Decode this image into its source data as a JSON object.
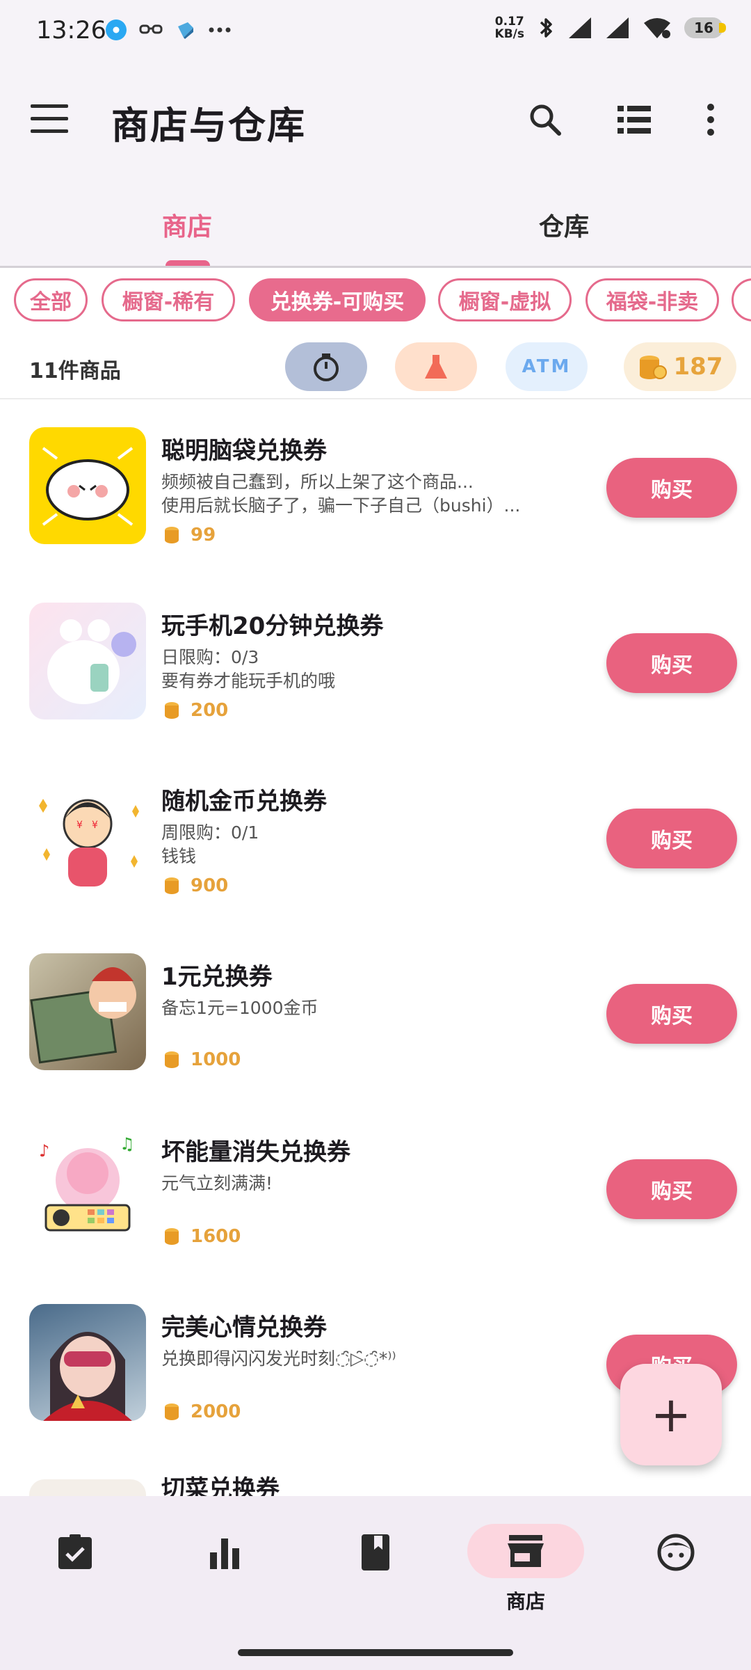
{
  "status_bar": {
    "time": "13:26",
    "net_speed": "0.17",
    "net_unit": "KB/s",
    "battery": "16"
  },
  "app_bar": {
    "title": "商店与仓库",
    "icons": [
      "menu-icon",
      "search-icon",
      "list-icon",
      "more-vert-icon"
    ]
  },
  "tabs": [
    {
      "label": "商店"
    },
    {
      "label": "仓库"
    }
  ],
  "chips": [
    {
      "label": "全部"
    },
    {
      "label": "橱窗-稀有"
    },
    {
      "label": "兑换券-可购买"
    },
    {
      "label": "橱窗-虚拟"
    },
    {
      "label": "福袋-非卖"
    }
  ],
  "summary": {
    "count": "11件商品",
    "atm": "ATM",
    "coins": "187"
  },
  "items": [
    {
      "name": "聪明脑袋兑换券",
      "line1": "频频被自己蠢到，所以上架了这个商品...",
      "line2": "使用后就长脑子了，骗一下子自己（bushi）...",
      "price": "99",
      "buy": "购买"
    },
    {
      "name": "玩手机20分钟兑换券",
      "line1": "日限购：0/3",
      "line2": "要有券才能玩手机的哦",
      "price": "200",
      "buy": "购买"
    },
    {
      "name": "随机金币兑换券",
      "line1": "周限购：0/1",
      "line2": "钱钱",
      "price": "900",
      "buy": "购买"
    },
    {
      "name": "1元兑换券",
      "line1": "备忘1元=1000金币",
      "line2": "",
      "price": "1000",
      "buy": "购买"
    },
    {
      "name": "坏能量消失兑换券",
      "line1": "元气立刻满满!",
      "line2": "",
      "price": "1600",
      "buy": "购买"
    },
    {
      "name": "完美心情兑换券",
      "line1": "兑换即得闪闪发光时刻◌̑̑▷̑̑◌̑̑*⁾⁾",
      "line2": "",
      "price": "2000",
      "buy": "购买"
    },
    {
      "name": "切菜兑换券",
      "line1": "",
      "line2": "",
      "price": "",
      "buy": ""
    }
  ],
  "fab": {
    "label": "+"
  },
  "nav": [
    {
      "label": "",
      "icon": "task-check-icon"
    },
    {
      "label": "",
      "icon": "bar-chart-icon"
    },
    {
      "label": "",
      "icon": "bookmark-icon"
    },
    {
      "label": "商店",
      "icon": "store-icon"
    },
    {
      "label": "",
      "icon": "face-icon"
    }
  ],
  "colors": {
    "accent": "#e8648a",
    "buy": "#e9627f",
    "coin": "#e6a23b",
    "fab": "#fdd7e0"
  }
}
